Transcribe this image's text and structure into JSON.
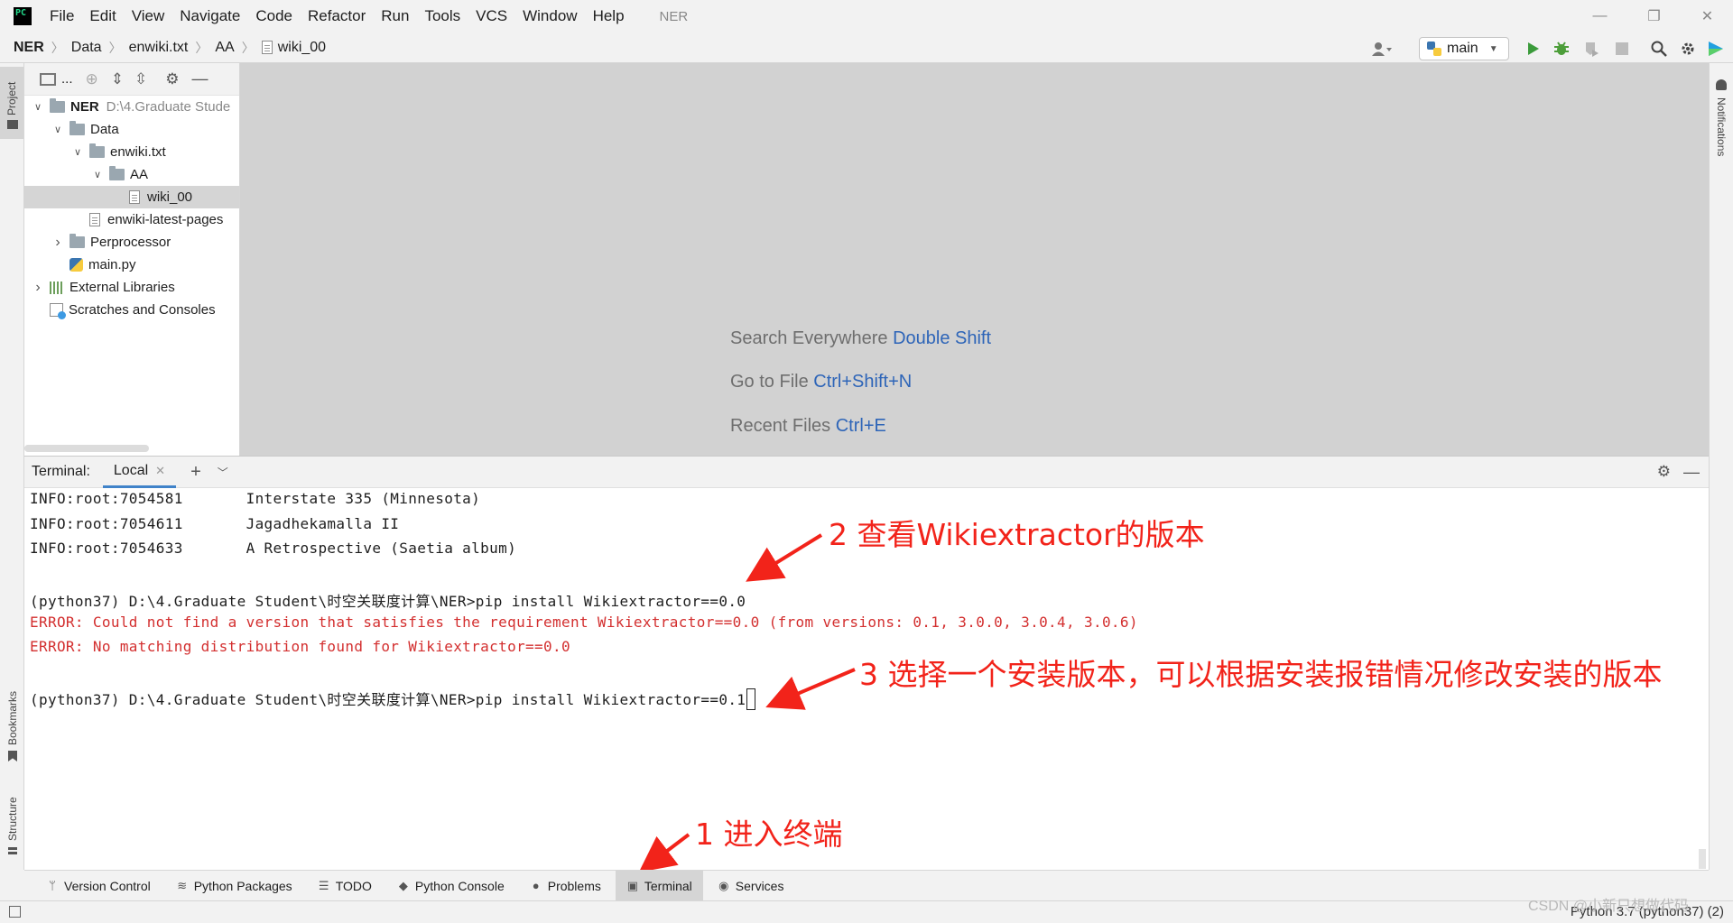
{
  "app": {
    "logo_text": "PC",
    "project_title": "NER",
    "menu": [
      "File",
      "Edit",
      "View",
      "Navigate",
      "Code",
      "Refactor",
      "Run",
      "Tools",
      "VCS",
      "Window",
      "Help"
    ],
    "window_controls": {
      "minimize": "—",
      "restore": "❐",
      "close": "✕"
    }
  },
  "breadcrumb": [
    "NER",
    "Data",
    "enwiki.txt",
    "AA",
    "wiki_00"
  ],
  "toolbar": {
    "run_config": "main",
    "icons": [
      "user-icon",
      "python-icon",
      "run-icon",
      "debug-icon",
      "coverage-icon",
      "stop-icon",
      "search-icon",
      "gear-icon",
      "jetbrains-icon"
    ]
  },
  "left_strip": {
    "project": "Project",
    "bookmarks": "Bookmarks",
    "structure": "Structure"
  },
  "right_strip": {
    "notifications": "Notifications"
  },
  "project_panel": {
    "toolbar_label": "...",
    "tree": [
      {
        "label": "NER",
        "hint": "D:\\4.Graduate Stude",
        "depth": 0,
        "expanded": true,
        "kind": "folder"
      },
      {
        "label": "Data",
        "depth": 1,
        "expanded": true,
        "kind": "folder"
      },
      {
        "label": "enwiki.txt",
        "depth": 2,
        "expanded": true,
        "kind": "folder"
      },
      {
        "label": "AA",
        "depth": 3,
        "expanded": true,
        "kind": "folder"
      },
      {
        "label": "wiki_00",
        "depth": 4,
        "kind": "file",
        "selected": true
      },
      {
        "label": "enwiki-latest-pages",
        "depth": 2,
        "kind": "file"
      },
      {
        "label": "Perprocessor",
        "depth": 1,
        "expanded": false,
        "kind": "folder"
      },
      {
        "label": "main.py",
        "depth": 1,
        "kind": "python"
      },
      {
        "label": "External Libraries",
        "depth": 0,
        "expanded": false,
        "kind": "library"
      },
      {
        "label": "Scratches and Consoles",
        "depth": 0,
        "kind": "scratch"
      }
    ]
  },
  "editor": {
    "hints": [
      {
        "text": "Search Everywhere",
        "key": "Double Shift"
      },
      {
        "text": "Go to File",
        "key": "Ctrl+Shift+N"
      },
      {
        "text": "Recent Files",
        "key": "Ctrl+E"
      }
    ]
  },
  "terminal": {
    "label": "Terminal:",
    "tab": "Local",
    "lines": [
      {
        "text": "INFO:root:7054581       Interstate 335 (Minnesota)",
        "type": "info"
      },
      {
        "text": "INFO:root:7054611       Jagadhekamalla II",
        "type": "info"
      },
      {
        "text": "INFO:root:7054633       A Retrospective (Saetia album)",
        "type": "info"
      },
      {
        "text": "",
        "type": "blank"
      },
      {
        "text": "(python37) D:\\4.Graduate Student\\时空关联度计算\\NER>pip install Wikiextractor==0.0",
        "type": "cmd"
      },
      {
        "text": "ERROR: Could not find a version that satisfies the requirement Wikiextractor==0.0 (from versions: 0.1, 3.0.0, 3.0.4, 3.0.6)",
        "type": "err"
      },
      {
        "text": "ERROR: No matching distribution found for Wikiextractor==0.0",
        "type": "err"
      },
      {
        "text": "",
        "type": "blank"
      },
      {
        "text": "(python37) D:\\4.Graduate Student\\时空关联度计算\\NER>pip install Wikiextractor==0.1",
        "type": "cmd"
      }
    ]
  },
  "annotations": {
    "a1": "1 进入终端",
    "a2": "2 查看Wikiextractor的版本",
    "a3": "3 选择一个安装版本，可以根据安装报错情况修改安装的版本",
    "color": "#f2231a"
  },
  "bottom_tabs": [
    {
      "label": "Version Control",
      "icon": "branch-icon"
    },
    {
      "label": "Python Packages",
      "icon": "layers-icon"
    },
    {
      "label": "TODO",
      "icon": "list-icon"
    },
    {
      "label": "Python Console",
      "icon": "python-icon"
    },
    {
      "label": "Problems",
      "icon": "alert-icon"
    },
    {
      "label": "Terminal",
      "icon": "terminal-icon",
      "active": true
    },
    {
      "label": "Services",
      "icon": "play-circle-icon"
    }
  ],
  "status": {
    "interpreter": "Python 3.7 (python37) (2)",
    "watermark": "CSDN @小新只想做代码"
  }
}
